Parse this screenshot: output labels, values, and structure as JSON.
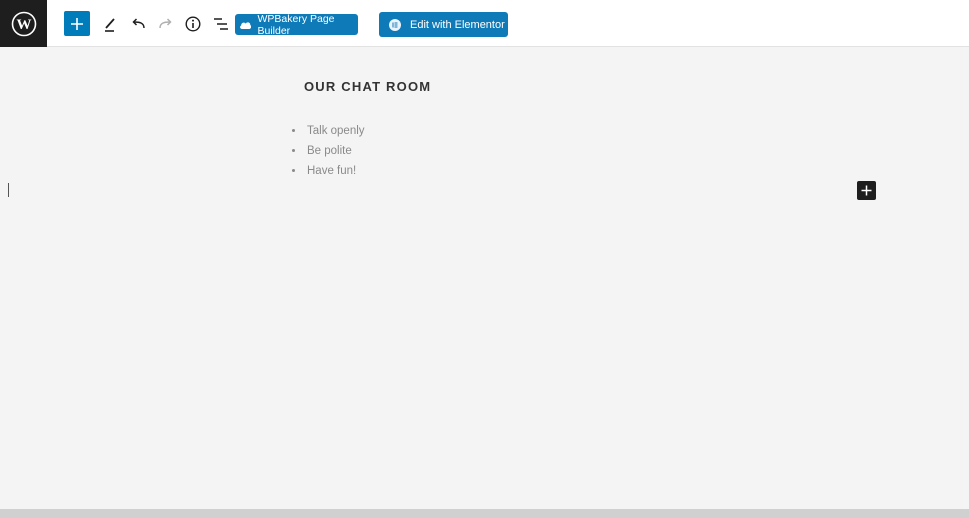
{
  "toolbar": {
    "wpbakery_label": "WPBakery Page Builder",
    "elementor_label": "Edit with Elementor",
    "icons": [
      "wordpress-logo-icon",
      "plus-icon",
      "pencil-icon",
      "undo-icon",
      "redo-icon",
      "info-icon",
      "list-view-icon",
      "wpbakery-cloud-icon",
      "elementor-icon"
    ],
    "accent_color": "#007cba"
  },
  "content": {
    "heading": "OUR CHAT ROOM",
    "items": [
      "Talk openly",
      "Be polite",
      "Have fun!"
    ]
  }
}
